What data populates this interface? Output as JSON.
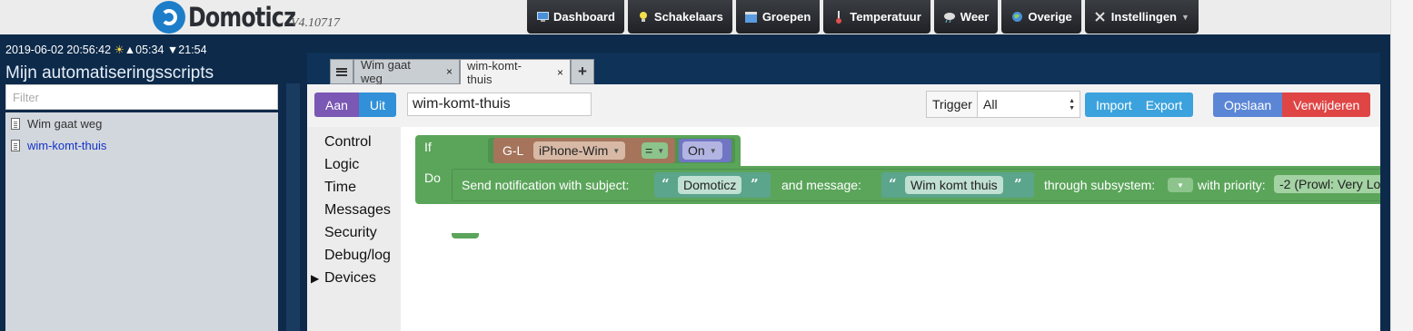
{
  "header": {
    "logo_name": "Domoticz",
    "logo_version": "V4.10717",
    "nav": [
      {
        "label": "Dashboard",
        "icon": "monitor-icon"
      },
      {
        "label": "Schakelaars",
        "icon": "lightbulb-icon"
      },
      {
        "label": "Groepen",
        "icon": "clapperboard-icon"
      },
      {
        "label": "Temperatuur",
        "icon": "thermometer-icon"
      },
      {
        "label": "Weer",
        "icon": "cloud-rain-icon"
      },
      {
        "label": "Overige",
        "icon": "globe-icon"
      },
      {
        "label": "Instellingen",
        "icon": "tools-icon"
      }
    ]
  },
  "status": {
    "datetime": "2019-06-02 20:56:42",
    "sunrise": "05:34",
    "sunset": "21:54"
  },
  "sidebar": {
    "title": "Mijn automatiseringsscripts",
    "filter_placeholder": "Filter",
    "scripts": [
      {
        "label": "Wim gaat weg",
        "active": false
      },
      {
        "label": "wim-komt-thuis",
        "active": true
      }
    ]
  },
  "editor": {
    "tabs": [
      {
        "label": "Wim gaat weg",
        "active": false
      },
      {
        "label": "wim-komt-thuis",
        "active": true
      }
    ],
    "toolbar": {
      "on_label": "Aan",
      "off_label": "Uit",
      "script_name": "wim-komt-thuis",
      "trigger_label": "Trigger",
      "trigger_value": "All",
      "import_label": "Import",
      "export_label": "Export",
      "save_label": "Opslaan",
      "delete_label": "Verwijderen"
    },
    "toolbox": [
      "Control",
      "Logic",
      "Time",
      "Messages",
      "Security",
      "Debug/log",
      "Devices"
    ],
    "blocks": {
      "if_label": "If",
      "do_label": "Do",
      "device_group": "G-L",
      "device_name": "iPhone-Wim",
      "operator": "=",
      "state": "On",
      "notify_label": "Send notification with subject:",
      "subject": "Domoticz",
      "message_label": "and message:",
      "message": "Wim komt thuis",
      "subsystem_label": "through subsystem:",
      "priority_label": "with priority:",
      "priority": "-2 (Prowl: Very Lo"
    }
  },
  "colors": {
    "main_bg": "#0d2a4a",
    "block_green": "#5ba55b",
    "device_brown": "#a5745b",
    "state_purple": "#7075c4",
    "text_teal": "#5ba58c",
    "on_purple": "#7a58b3",
    "off_blue": "#3190d8",
    "delete_red": "#e04545"
  }
}
